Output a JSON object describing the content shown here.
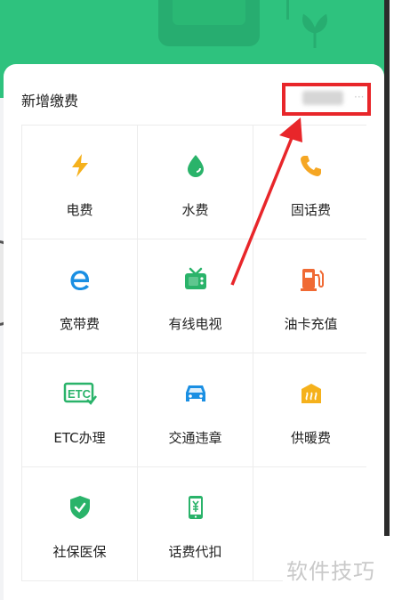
{
  "section": {
    "title": "新增缴费"
  },
  "services": [
    {
      "label": "电费",
      "icon": "lightning-icon",
      "color": "#f5b11c"
    },
    {
      "label": "水费",
      "icon": "water-drop-icon",
      "color": "#2ab36a"
    },
    {
      "label": "固话费",
      "icon": "phone-icon",
      "color": "#f5a623"
    },
    {
      "label": "宽带费",
      "icon": "broadband-e-icon",
      "color": "#1a8fe3"
    },
    {
      "label": "有线电视",
      "icon": "tv-icon",
      "color": "#2ab36a"
    },
    {
      "label": "油卡充值",
      "icon": "fuel-pump-icon",
      "color": "#f06a34"
    },
    {
      "label": "ETC办理",
      "icon": "etc-icon",
      "color": "#2ab36a"
    },
    {
      "label": "交通违章",
      "icon": "car-icon",
      "color": "#1a8fe3"
    },
    {
      "label": "供暖费",
      "icon": "heating-icon",
      "color": "#f5b11c"
    },
    {
      "label": "社保医保",
      "icon": "shield-check-icon",
      "color": "#2ab36a"
    },
    {
      "label": "话费代扣",
      "icon": "mobile-yuan-icon",
      "color": "#2ab36a"
    }
  ],
  "annotation": {
    "highlight_color": "#e8262a"
  },
  "watermark": {
    "text": "软件技巧"
  },
  "theme": {
    "banner_green": "#2ec27e"
  }
}
